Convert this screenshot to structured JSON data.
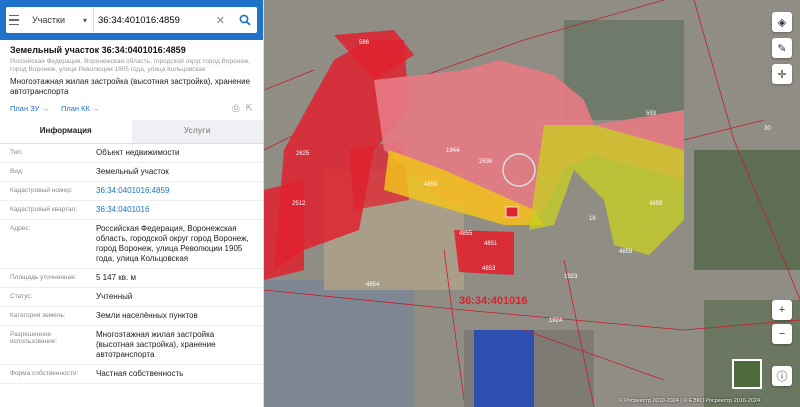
{
  "search": {
    "type_label": "Участки",
    "query": "36:34:401016:4859"
  },
  "card": {
    "title": "Земельный участок 36:34:0401016:4859",
    "address_grey": "Российская Федерация, Воронежская область, городской округ город Воронеж, город Воронеж, улица Революции 1905 года, улица Кольцовская",
    "purpose": "Многоэтажная жилая застройка (высотная застройка), хранение автотранспорта",
    "link_zu": "План ЗУ →",
    "link_kk": "План КК →"
  },
  "tabs": {
    "info": "Информация",
    "services": "Услуги"
  },
  "fields": {
    "type_k": "Тип:",
    "type_v": "Объект недвижимости",
    "kind_k": "Вид:",
    "kind_v": "Земельный участок",
    "cad_k": "Кадастровый номер:",
    "cad_v": "36:34:0401016:4859",
    "quarter_k": "Кадастровый квартал:",
    "quarter_v": "36:34:0401016",
    "addr_k": "Адрес:",
    "addr_v": "Российская Федерация, Воронежская область, городской округ город Воронеж, город Воронеж, улица Революции 1905 года, улица Кольцовская",
    "area_k": "Площадь уточненная:",
    "area_v": "5 147 кв. м",
    "status_k": "Статус:",
    "status_v": "Учтенный",
    "cat_k": "Категория земель:",
    "cat_v": "Земли населённых пунктов",
    "use_k": "Разрешенное использование:",
    "use_v": "Многоэтажная жилая застройка (высотная застройка), хранение автотранспорта",
    "own_k": "Форма собственности:",
    "own_v": "Частная собственность"
  },
  "map": {
    "labels": {
      "l1944": "1944",
      "l2636": "2636",
      "l4859a": "4859",
      "l4859b": "4859",
      "l4859c": "4859",
      "l4855": "4855",
      "l4854": "4854",
      "l4851": "4851",
      "l4853": "4853",
      "l593": "593",
      "l2512": "2512",
      "l2625": "2625",
      "l586": "586",
      "l30": "30",
      "l1923": "1923",
      "quarter": "36:34:401016",
      "l1924": "1924",
      "l16": "16"
    },
    "copyright": "© Росреестр 2010-2024 | © ЕЭКО Росреестр 2016-2024"
  },
  "colors": {
    "accent": "#1e73c8",
    "parcel_red": "#e0212f",
    "parcel_pink": "#e77a84",
    "parcel_yellow": "#f0c21c",
    "parcel_lime": "#c8d21e"
  }
}
